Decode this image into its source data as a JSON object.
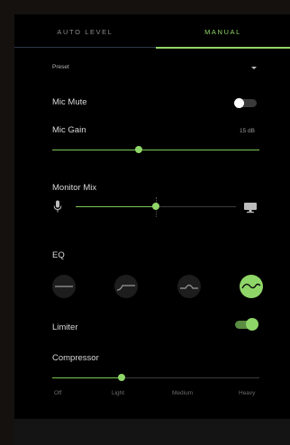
{
  "tabs": [
    {
      "label": "AUTO LEVEL",
      "active": false
    },
    {
      "label": "MANUAL",
      "active": true
    }
  ],
  "preset": {
    "label": "Preset",
    "value": ""
  },
  "mic_mute": {
    "label": "Mic Mute",
    "on": false
  },
  "mic_gain": {
    "label": "Mic Gain",
    "value_text": "15 dB",
    "fraction": 0.42
  },
  "monitor_mix": {
    "label": "Monitor Mix",
    "fraction": 0.48,
    "left_icon": "microphone-icon",
    "right_icon": "monitor-icon"
  },
  "eq": {
    "label": "EQ",
    "options": [
      {
        "icon": "eq-flat-icon",
        "active": false
      },
      {
        "icon": "eq-low-cut-icon",
        "active": false
      },
      {
        "icon": "eq-mid-boost-icon",
        "active": false
      },
      {
        "icon": "eq-wave-icon",
        "active": true
      }
    ]
  },
  "limiter": {
    "label": "Limiter",
    "on": true
  },
  "compressor": {
    "label": "Compressor",
    "fraction": 0.33,
    "levels": [
      "Off",
      "Light",
      "Medium",
      "Heavy"
    ]
  },
  "colors": {
    "accent": "#8fd668",
    "panel": "#000000",
    "background": "#15110f"
  }
}
